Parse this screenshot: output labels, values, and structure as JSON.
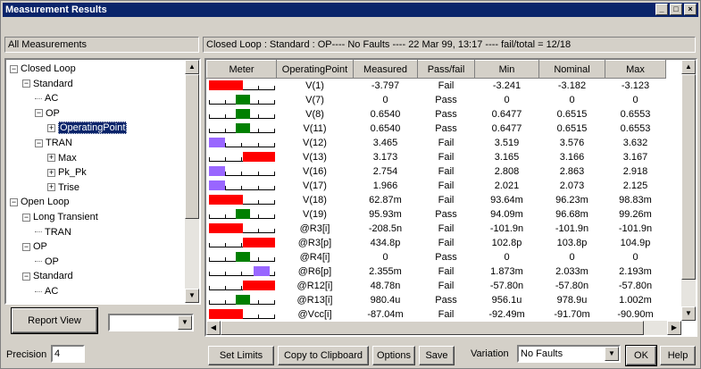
{
  "window": {
    "title": "Measurement Results",
    "controls": [
      "_",
      "□",
      "×"
    ]
  },
  "left_header": "All Measurements",
  "status_bar": "Closed Loop : Standard : OP---- No Faults ----   22 Mar 99, 13:17 ---- fail/total = 12/18",
  "tree": [
    {
      "label": "Closed Loop",
      "level": 0,
      "expander": "−"
    },
    {
      "label": "Standard",
      "level": 1,
      "expander": "−"
    },
    {
      "label": "AC",
      "level": 2,
      "expander": ""
    },
    {
      "label": "OP",
      "level": 2,
      "expander": "−"
    },
    {
      "label": "OperatingPoint",
      "level": 3,
      "expander": "+",
      "selected": true
    },
    {
      "label": "TRAN",
      "level": 2,
      "expander": "−"
    },
    {
      "label": "Max",
      "level": 3,
      "expander": "+"
    },
    {
      "label": "Pk_Pk",
      "level": 3,
      "expander": "+"
    },
    {
      "label": "Trise",
      "level": 3,
      "expander": "+"
    },
    {
      "label": "Open Loop",
      "level": 0,
      "expander": "−"
    },
    {
      "label": "Long Transient",
      "level": 1,
      "expander": "−"
    },
    {
      "label": "TRAN",
      "level": 2,
      "expander": ""
    },
    {
      "label": "OP",
      "level": 1,
      "expander": "−"
    },
    {
      "label": "OP",
      "level": 2,
      "expander": ""
    },
    {
      "label": "Standard",
      "level": 1,
      "expander": "−"
    },
    {
      "label": "AC",
      "level": 2,
      "expander": ""
    }
  ],
  "grid": {
    "columns": [
      "Meter",
      "OperatingPoint",
      "Measured",
      "Pass/fail",
      "Min",
      "Nominal",
      "Max"
    ],
    "rows": [
      {
        "meter": "red-left",
        "op": "V(1)",
        "measured": "-3.797",
        "pf": "Fail",
        "min": "-3.241",
        "nom": "-3.182",
        "max": "-3.123"
      },
      {
        "meter": "green",
        "op": "V(7)",
        "measured": "0",
        "pf": "Pass",
        "min": "0",
        "nom": "0",
        "max": "0"
      },
      {
        "meter": "green",
        "op": "V(8)",
        "measured": "0.6540",
        "pf": "Pass",
        "min": "0.6477",
        "nom": "0.6515",
        "max": "0.6553"
      },
      {
        "meter": "green",
        "op": "V(11)",
        "measured": "0.6540",
        "pf": "Pass",
        "min": "0.6477",
        "nom": "0.6515",
        "max": "0.6553"
      },
      {
        "meter": "purple-left",
        "op": "V(12)",
        "measured": "3.465",
        "pf": "Fail",
        "min": "3.519",
        "nom": "3.576",
        "max": "3.632"
      },
      {
        "meter": "red-right",
        "op": "V(13)",
        "measured": "3.173",
        "pf": "Fail",
        "min": "3.165",
        "nom": "3.166",
        "max": "3.167"
      },
      {
        "meter": "purple-left",
        "op": "V(16)",
        "measured": "2.754",
        "pf": "Fail",
        "min": "2.808",
        "nom": "2.863",
        "max": "2.918"
      },
      {
        "meter": "purple-left",
        "op": "V(17)",
        "measured": "1.966",
        "pf": "Fail",
        "min": "2.021",
        "nom": "2.073",
        "max": "2.125"
      },
      {
        "meter": "red-left",
        "op": "V(18)",
        "measured": "62.87m",
        "pf": "Fail",
        "min": "93.64m",
        "nom": "96.23m",
        "max": "98.83m"
      },
      {
        "meter": "green",
        "op": "V(19)",
        "measured": "95.93m",
        "pf": "Pass",
        "min": "94.09m",
        "nom": "96.68m",
        "max": "99.26m"
      },
      {
        "meter": "red-left",
        "op": "@R3[i]",
        "measured": "-208.5n",
        "pf": "Fail",
        "min": "-101.9n",
        "nom": "-101.9n",
        "max": "-101.9n"
      },
      {
        "meter": "red-right",
        "op": "@R3[p]",
        "measured": "434.8p",
        "pf": "Fail",
        "min": "102.8p",
        "nom": "103.8p",
        "max": "104.9p"
      },
      {
        "meter": "green",
        "op": "@R4[i]",
        "measured": "0",
        "pf": "Pass",
        "min": "0",
        "nom": "0",
        "max": "0"
      },
      {
        "meter": "purple-right",
        "op": "@R6[p]",
        "measured": "2.355m",
        "pf": "Fail",
        "min": "1.873m",
        "nom": "2.033m",
        "max": "2.193m"
      },
      {
        "meter": "red-right",
        "op": "@R12[i]",
        "measured": "48.78n",
        "pf": "Fail",
        "min": "-57.80n",
        "nom": "-57.80n",
        "max": "-57.80n"
      },
      {
        "meter": "green",
        "op": "@R13[i]",
        "measured": "980.4u",
        "pf": "Pass",
        "min": "956.1u",
        "nom": "978.9u",
        "max": "1.002m"
      },
      {
        "meter": "red-left",
        "op": "@Vcc[i]",
        "measured": "-87.04m",
        "pf": "Fail",
        "min": "-92.49m",
        "nom": "-91.70m",
        "max": "-90.90m"
      }
    ]
  },
  "buttons": {
    "report_view": "Report View",
    "set_limits": "Set Limits",
    "copy_clipboard": "Copy to Clipboard",
    "options": "Options",
    "save": "Save",
    "ok": "OK",
    "help": "Help"
  },
  "precision": {
    "label": "Precision",
    "value": "4"
  },
  "variation": {
    "label": "Variation",
    "value": "No Faults"
  },
  "colors": {
    "title_bar": "#0a246a",
    "fail_red": "#ff0000",
    "pass_green": "#008000",
    "deviation_purple": "#9966ff"
  }
}
